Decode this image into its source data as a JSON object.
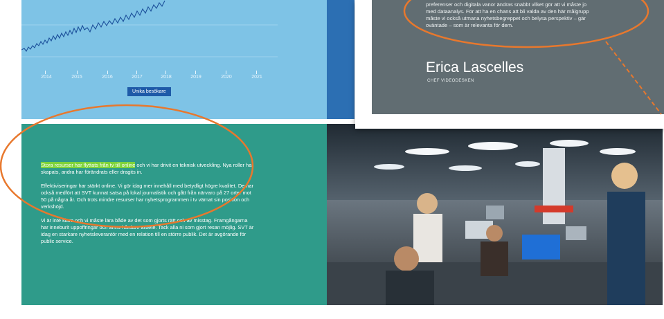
{
  "chart": {
    "years": [
      "2014",
      "2015",
      "2016",
      "2017",
      "2018",
      "2019",
      "2020",
      "2021"
    ],
    "legend_label": "Unika besökare"
  },
  "article": {
    "highlight": "Stora resurser har flyttats från tv till online",
    "p1_rest": " och vi har drivit en teknisk utveckling. Nya roller har skapats, andra har förändrats eller dragits in.",
    "p2": "Effektiviseringar har stärkt online. Vi gör idag mer innehåll med betydligt högre kvalitet. De har också medfört att SVT kunnat satsa på lokal journalistik och gått från närvaro på 27 orter mot 50 på några år. Och trots mindre resurser har nyhetsprogrammen i tv värnat sin position och verkshöjd.",
    "p3": "Vi är inte klara och vi måste lära både av det som gjorts rätt och av misstag. Framgångarna har inneburit uppoffringar och ännu hårdare arbete. Tack alla ni som gjort resan möjlig. SVT är idag en starkare nyhetsleverantör med en relation till en större publik. Det är avgörande för public service."
  },
  "quote_card": {
    "line1": "preferenser och digitala vanor ändras snabbt vilket gör att vi måste jo",
    "line2": "med dataanalys. För att ha en chans att bli valda av den här målgrupp",
    "line3": "måste vi också utmana nyhetsbegreppet och belysa perspektiv – gär",
    "line4": "oväntade – som är relevanta för dem.",
    "author_name": "Erica Lascelles",
    "author_role": "CHEF VIDEODESKEN"
  },
  "colors": {
    "chart_bg": "#7ec3e6",
    "teal": "#2f9b8a",
    "highlight": "#7ed33a",
    "annotation": "#e8782d",
    "card_bg": "#616d72"
  }
}
